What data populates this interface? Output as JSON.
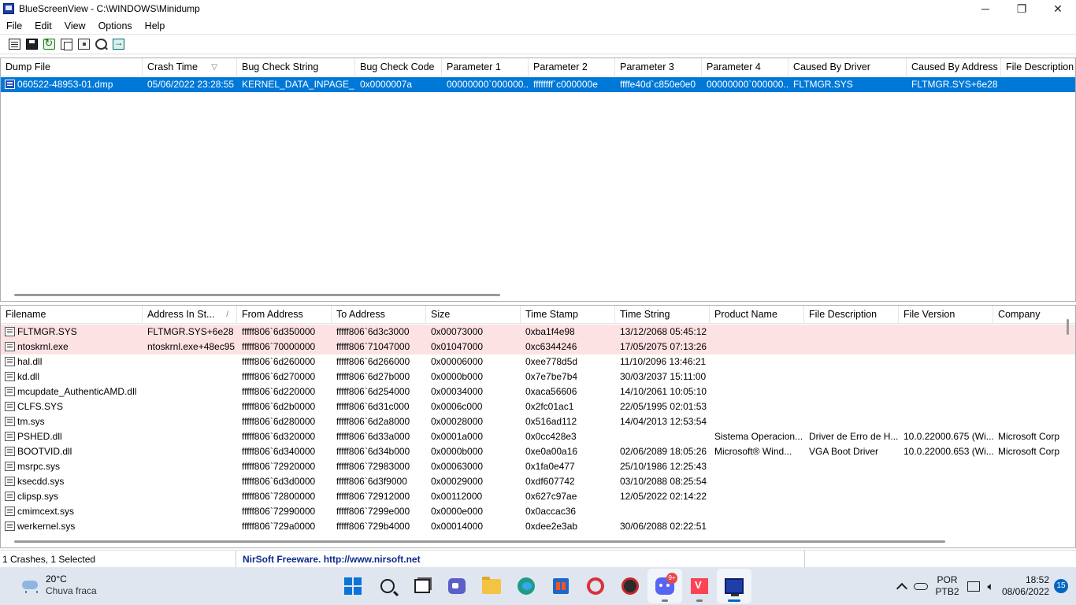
{
  "window": {
    "title": "BlueScreenView  -  C:\\WINDOWS\\Minidump",
    "minimize": "─",
    "restore": "❐",
    "close": "✕"
  },
  "menu": [
    "File",
    "Edit",
    "View",
    "Options",
    "Help"
  ],
  "toolbar": {
    "buttons": [
      "properties-icon",
      "save-icon",
      "refresh-icon",
      "copy-icon",
      "html-report-icon",
      "find-icon",
      "exit-icon"
    ]
  },
  "crash_list": {
    "columns": [
      "Dump File",
      "Crash Time",
      "Bug Check String",
      "Bug Check Code",
      "Parameter 1",
      "Parameter 2",
      "Parameter 3",
      "Parameter 4",
      "Caused By Driver",
      "Caused By Address",
      "File Description"
    ],
    "sort_indicator": "▽",
    "rows": [
      [
        "060522-48953-01.dmp",
        "05/06/2022 23:28:55",
        "KERNEL_DATA_INPAGE_...",
        "0x0000007a",
        "00000000`000000...",
        "ffffffff`c000000e",
        "ffffe40d`c850e0e0",
        "00000000`000000...",
        "FLTMGR.SYS",
        "FLTMGR.SYS+6e28",
        ""
      ]
    ]
  },
  "driver_list": {
    "columns": [
      "Filename",
      "Address In St...",
      "From Address",
      "To Address",
      "Size",
      "Time Stamp",
      "Time String",
      "Product Name",
      "File Description",
      "File Version",
      "Company"
    ],
    "sort_indicator": "/",
    "rows": [
      [
        "FLTMGR.SYS",
        "FLTMGR.SYS+6e28",
        "fffff806`6d350000",
        "fffff806`6d3c3000",
        "0x00073000",
        "0xba1f4e98",
        "13/12/2068 05:45:12",
        "",
        "",
        "",
        ""
      ],
      [
        "ntoskrnl.exe",
        "ntoskrnl.exe+48ec95",
        "fffff806`70000000",
        "fffff806`71047000",
        "0x01047000",
        "0xc6344246",
        "17/05/2075 07:13:26",
        "",
        "",
        "",
        ""
      ],
      [
        "hal.dll",
        "",
        "fffff806`6d260000",
        "fffff806`6d266000",
        "0x00006000",
        "0xee778d5d",
        "11/10/2096 13:46:21",
        "",
        "",
        "",
        ""
      ],
      [
        "kd.dll",
        "",
        "fffff806`6d270000",
        "fffff806`6d27b000",
        "0x0000b000",
        "0x7e7be7b4",
        "30/03/2037 15:11:00",
        "",
        "",
        "",
        ""
      ],
      [
        "mcupdate_AuthenticAMD.dll",
        "",
        "fffff806`6d220000",
        "fffff806`6d254000",
        "0x00034000",
        "0xaca56606",
        "14/10/2061 10:05:10",
        "",
        "",
        "",
        ""
      ],
      [
        "CLFS.SYS",
        "",
        "fffff806`6d2b0000",
        "fffff806`6d31c000",
        "0x0006c000",
        "0x2fc01ac1",
        "22/05/1995 02:01:53",
        "",
        "",
        "",
        ""
      ],
      [
        "tm.sys",
        "",
        "fffff806`6d280000",
        "fffff806`6d2a8000",
        "0x00028000",
        "0x516ad112",
        "14/04/2013 12:53:54",
        "",
        "",
        "",
        ""
      ],
      [
        "PSHED.dll",
        "",
        "fffff806`6d320000",
        "fffff806`6d33a000",
        "0x0001a000",
        "0x0cc428e3",
        "",
        "Sistema Operacion...",
        "Driver de Erro de H...",
        "10.0.22000.675 (Wi...",
        "Microsoft Corp"
      ],
      [
        "BOOTVID.dll",
        "",
        "fffff806`6d340000",
        "fffff806`6d34b000",
        "0x0000b000",
        "0xe0a00a16",
        "02/06/2089 18:05:26",
        "Microsoft® Wind...",
        "VGA Boot Driver",
        "10.0.22000.653 (Wi...",
        "Microsoft Corp"
      ],
      [
        "msrpc.sys",
        "",
        "fffff806`72920000",
        "fffff806`72983000",
        "0x00063000",
        "0x1fa0e477",
        "25/10/1986 12:25:43",
        "",
        "",
        "",
        ""
      ],
      [
        "ksecdd.sys",
        "",
        "fffff806`6d3d0000",
        "fffff806`6d3f9000",
        "0x00029000",
        "0xdf607742",
        "03/10/2088 08:25:54",
        "",
        "",
        "",
        ""
      ],
      [
        "clipsp.sys",
        "",
        "fffff806`72800000",
        "fffff806`72912000",
        "0x00112000",
        "0x627c97ae",
        "12/05/2022 02:14:22",
        "",
        "",
        "",
        ""
      ],
      [
        "cmimcext.sys",
        "",
        "fffff806`72990000",
        "fffff806`7299e000",
        "0x0000e000",
        "0x0accac36",
        "",
        "",
        "",
        "",
        ""
      ],
      [
        "werkernel.sys",
        "",
        "fffff806`729a0000",
        "fffff806`729b4000",
        "0x00014000",
        "0xdee2e3ab",
        "30/06/2088 02:22:51",
        "",
        "",
        "",
        ""
      ]
    ],
    "highlight_rows": [
      0,
      1
    ]
  },
  "status": {
    "count": "1 Crashes, 1 Selected",
    "link": "NirSoft Freeware.  http://www.nirsoft.net"
  },
  "taskbar": {
    "weather_temp": "20°C",
    "weather_desc": "Chuva fraca",
    "discord_badge": "9+",
    "lang_top": "POR",
    "lang_bottom": "PTB2",
    "time": "18:52",
    "date": "08/06/2022",
    "notifications": "15"
  },
  "colors": {
    "selection": "#0078d7",
    "highlight": "#fde2e4",
    "link": "#0b2b8a",
    "taskbar": "#dfe6f0"
  }
}
